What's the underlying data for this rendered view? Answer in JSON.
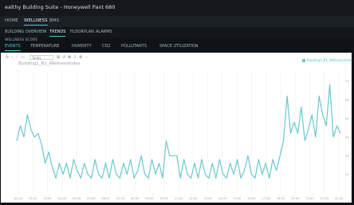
{
  "app": {
    "title": "ealthy Building Suite - Honeywell Pant 680"
  },
  "nav": {
    "primary": [
      "HOME",
      "WELLNESS",
      "BMS"
    ],
    "primary_active": 1,
    "secondary": [
      "BUILDING OVERVIEW",
      "TRENDS",
      "FLOORPLAN",
      "ALARMS"
    ],
    "secondary_active": 1
  },
  "section_label": "WELLNESS SCORE",
  "tabs": {
    "items": [
      "EVENTS",
      "TEMPERATURE",
      "HUMIDITY",
      "CO2",
      "POLLUTANTS",
      "SPACE UTILIZATION"
    ],
    "active": 0
  },
  "toolbar": {
    "select_value": "Today"
  },
  "chart_data": {
    "type": "line",
    "title": "Building1_B1_Wellnessindex",
    "series": [
      {
        "name": "Building1_B1_Wellnessindex",
        "color": "#6cc7cd",
        "values": [
          38,
          46,
          40,
          52,
          44,
          40,
          42,
          36,
          26,
          32,
          24,
          18,
          26,
          20,
          26,
          18,
          28,
          22,
          18,
          26,
          20,
          18,
          28,
          20,
          18,
          26,
          18,
          28,
          20,
          18,
          26,
          20,
          28,
          18,
          22,
          30,
          20,
          18,
          28,
          20,
          26,
          18,
          38,
          30,
          30,
          30,
          18,
          28,
          20,
          18,
          26,
          18,
          28,
          20,
          18,
          26,
          18,
          28,
          20,
          18,
          26,
          20,
          28,
          18,
          22,
          30,
          20,
          18,
          28,
          20,
          26,
          18,
          28,
          22,
          30,
          38,
          62,
          42,
          48,
          42,
          56,
          38,
          44,
          52,
          40,
          62,
          52,
          46,
          68,
          40,
          46,
          42
        ]
      }
    ],
    "ylim": [
      10,
      75
    ],
    "y_ticks": [
      "70",
      "60",
      "50",
      "40",
      "30",
      "20"
    ],
    "x_ticks": [
      "00:00",
      "01:00",
      "02:00",
      "03:00",
      "04:00",
      "05:00",
      "06:00",
      "07:00",
      "08:00",
      "09:00",
      "10:00",
      "11:00",
      "12:00",
      "13:00",
      "14:00",
      "15:00",
      "16:00",
      "17:00",
      "18:00",
      "19:00",
      "20:00",
      "21:00",
      "22:00"
    ],
    "grid": true,
    "legend_position": "top-right"
  }
}
